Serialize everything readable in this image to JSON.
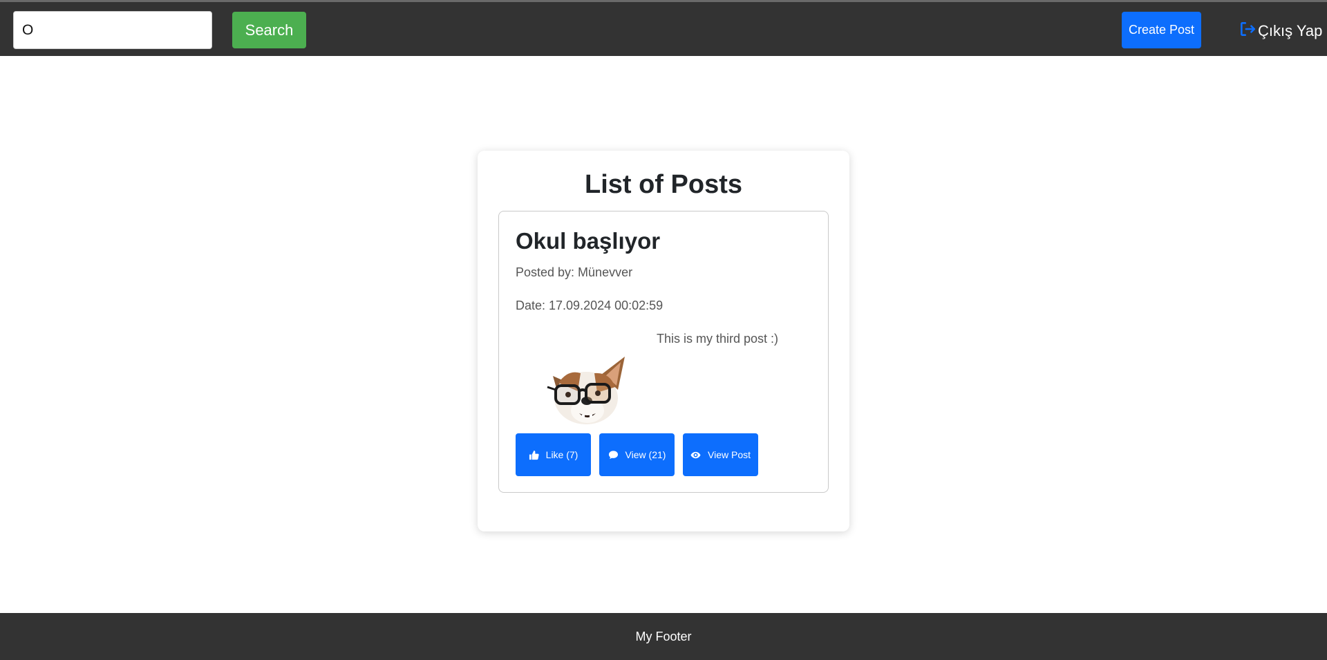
{
  "header": {
    "search_value": "O",
    "search_label": "Search",
    "create_post_label": "Create Post",
    "logout_label": "Çıkış Yap"
  },
  "main": {
    "title": "List of Posts",
    "posts": [
      {
        "title": "Okul başlıyor",
        "posted_by": "Posted by: Münevver",
        "date": "Date: 17.09.2024 00:02:59",
        "body": "This is my third post :)",
        "image_icon": "dog-with-glasses-photo",
        "actions": {
          "like_label": "Like (7)",
          "comments_label": "View (21)",
          "view_post_label": "View Post"
        }
      }
    ]
  },
  "footer": {
    "text": "My Footer"
  },
  "colors": {
    "topbar": "#333333",
    "search_button": "#4caf50",
    "primary": "#0d6efd",
    "footer": "#333333"
  }
}
